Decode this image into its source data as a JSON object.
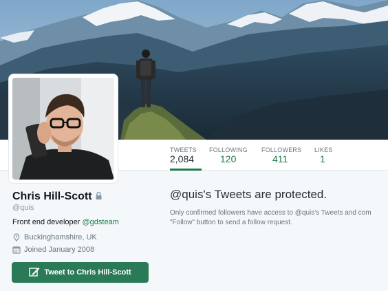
{
  "profile": {
    "name": "Chris Hill-Scott",
    "screen_name": "@quis",
    "bio_text": "Front end developer ",
    "bio_mention": "@gdsteam",
    "location": "Buckinghamshire, UK",
    "joined": "Joined January 2008",
    "tweet_to_label": "Tweet to Chris Hill-Scott"
  },
  "stats": [
    {
      "label": "TWEETS",
      "value": "2,084",
      "active": true
    },
    {
      "label": "FOLLOWING",
      "value": "120",
      "active": false
    },
    {
      "label": "FOLLOWERS",
      "value": "411",
      "active": false
    },
    {
      "label": "LIKES",
      "value": "1",
      "active": false
    }
  ],
  "protected": {
    "title": "@quis's Tweets are protected.",
    "line1": "Only confirmed followers have access to @quis's Tweets and com",
    "line2": "\"Follow\" button to send a follow request."
  },
  "colors": {
    "accent": "#1b7a48",
    "button": "#2b7a57",
    "background": "#f5f8fa"
  },
  "icons": [
    "lock-icon",
    "location-pin-icon",
    "calendar-icon",
    "compose-icon"
  ]
}
